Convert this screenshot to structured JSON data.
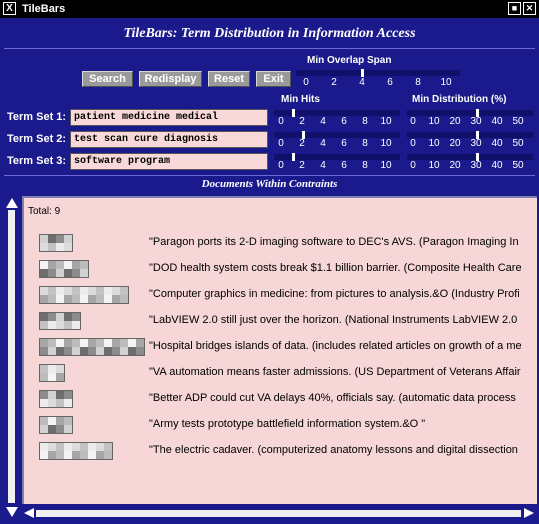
{
  "window": {
    "title": "TileBars",
    "app_heading": "TileBars: Term Distribution in Information Access"
  },
  "toolbar": {
    "search": "Search",
    "redisplay": "Redisplay",
    "reset": "Reset",
    "exit": "Exit"
  },
  "min_overlap": {
    "label": "Min Overlap Span",
    "ticks": [
      "0",
      "2",
      "4",
      "6",
      "8",
      "10"
    ],
    "value": 4
  },
  "min_hits": {
    "label": "Min Hits",
    "ticks": [
      "0",
      "2",
      "4",
      "6",
      "8",
      "10"
    ]
  },
  "min_dist": {
    "label": "Min Distribution (%)",
    "ticks": [
      "0",
      "10",
      "20",
      "30",
      "40",
      "50"
    ]
  },
  "term_sets": [
    {
      "label": "Term Set 1:",
      "value": "patient medicine medical",
      "hits": 1,
      "dist": 30
    },
    {
      "label": "Term Set 2:",
      "value": "test scan cure diagnosis",
      "hits": 2,
      "dist": 30
    },
    {
      "label": "Term Set 3:",
      "value": "software program",
      "hits": 1,
      "dist": 30
    }
  ],
  "docs": {
    "header": "Documents Within Contraints",
    "total": "Total: 9",
    "items": [
      {
        "title": "\"Paragon ports its 2-D imaging software to DEC's AVS. (Paragon Imaging In",
        "tiles": 4
      },
      {
        "title": "\"DOD health system costs break $1.1 billion barrier. (Composite Health Care",
        "tiles": 6
      },
      {
        "title": "\"Computer graphics in medicine: from pictures to analysis.&O  (Industry Profi",
        "tiles": 11
      },
      {
        "title": "\"LabVIEW 2.0 still just over the horizon. (National Instruments LabVIEW 2.0",
        "tiles": 5
      },
      {
        "title": "\"Hospital bridges islands of data. (includes related articles on growth of a me",
        "tiles": 13
      },
      {
        "title": "\"VA automation means faster admissions. (US Department of Veterans Affair",
        "tiles": 3
      },
      {
        "title": "\"Better ADP could cut VA delays 40%, officials say. (automatic data process",
        "tiles": 4
      },
      {
        "title": "\"Army tests prototype battlefield information system.&O \"",
        "tiles": 4
      },
      {
        "title": "\"The electric cadaver. (computerized anatomy lessons and digital dissection",
        "tiles": 9
      }
    ]
  },
  "colors": {
    "background": "#1a1a8c",
    "panel": "#f6d6d6",
    "button": "#9a9a9a",
    "input": "#f8d8d8"
  }
}
